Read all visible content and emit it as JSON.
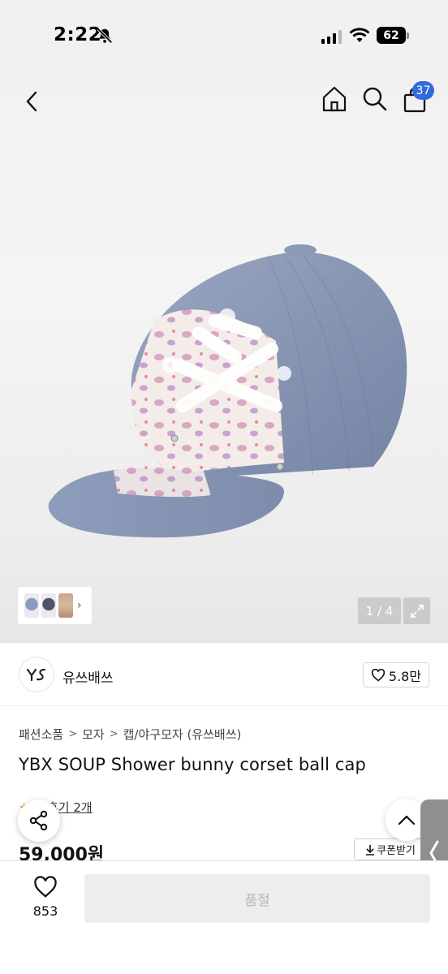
{
  "status_bar": {
    "time": "2:22",
    "battery": "62"
  },
  "nav": {
    "cart_count": "37"
  },
  "gallery": {
    "page_indicator": "1 / 4"
  },
  "brand": {
    "logo_text": "Y̴S",
    "name": "유쓰배쓰",
    "likes": "5.8만"
  },
  "product": {
    "breadcrumb": [
      "패션소품",
      "모자",
      "캡/야구모자 (유쓰배쓰)"
    ],
    "title": "YBX SOUP Shower bunny corset ball cap",
    "rating_partial": "5",
    "review_label": "후기 2개",
    "price": "59,000원",
    "coupon_label": "쿠폰받기"
  },
  "bottom_bar": {
    "wishlist_count": "853",
    "soldout_label": "품절"
  },
  "colors": {
    "badge": "#2f6bdc",
    "star": "#f28b1c",
    "disabled_bg": "#ededed"
  },
  "icons": [
    "back-chevron-icon",
    "home-icon",
    "search-icon",
    "shopping-bag-icon",
    "expand-icon",
    "heart-icon",
    "share-icon",
    "chevron-up-icon",
    "chevron-left-icon",
    "bell-slash-icon",
    "signal-icon",
    "wifi-icon",
    "battery-icon",
    "download-icon"
  ]
}
